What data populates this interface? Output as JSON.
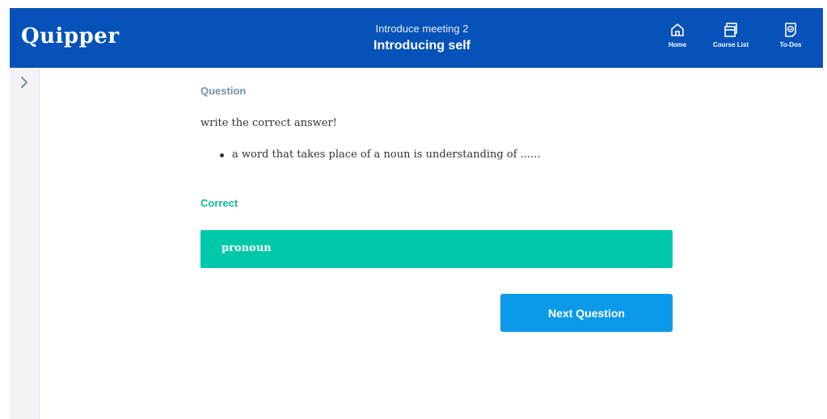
{
  "app": {
    "logo": "Quipper"
  },
  "header": {
    "subtitle": "Introduce meeting 2",
    "title": "Introducing self",
    "nav": [
      {
        "label": "Home",
        "icon": "home-icon"
      },
      {
        "label": "Course List",
        "icon": "course-list-icon"
      },
      {
        "label": "To-Dos",
        "icon": "todos-icon"
      }
    ]
  },
  "sidebar": {
    "toggle_icon": "chevron-right-icon"
  },
  "question": {
    "heading": "Question",
    "prompt": "write the correct answer!",
    "bullets": [
      "a word that takes place of a noun is understanding of ......"
    ]
  },
  "result": {
    "label": "Correct",
    "answer": "pronoun"
  },
  "actions": {
    "next_label": "Next Question"
  },
  "colors": {
    "header": "#0652b8",
    "correct": "#00c9ab",
    "correct_text": "#11b796",
    "button": "#0a9ae9",
    "heading": "#7590ad"
  }
}
